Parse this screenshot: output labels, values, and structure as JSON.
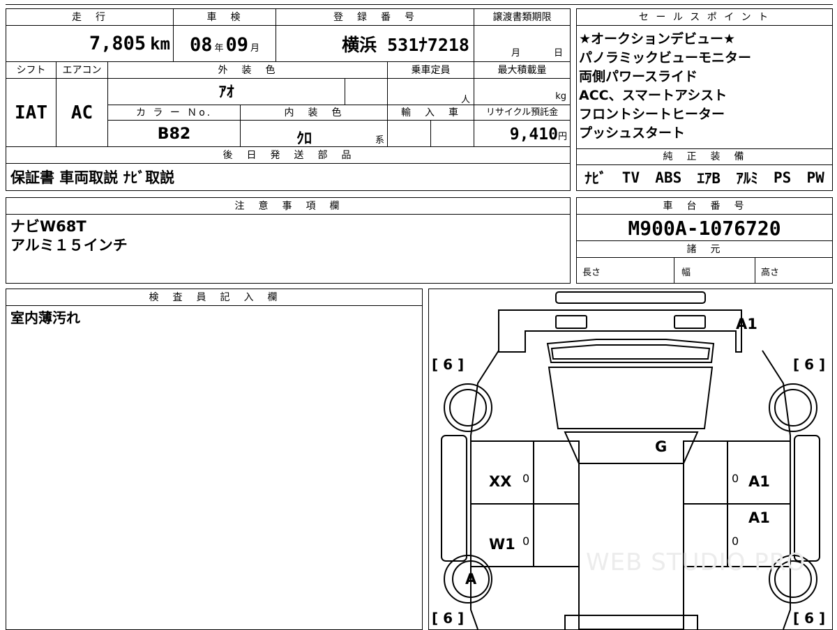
{
  "top": {
    "mileage_label": "走　行",
    "mileage_value": "7,805",
    "mileage_unit": "km",
    "inspection_label": "車　検",
    "inspection_year": "08",
    "inspection_year_unit": "年",
    "inspection_month": "09",
    "inspection_month_unit": "月",
    "registration_label": "登　録　番　号",
    "registration_value": "横浜 531ﾅ7218",
    "deadline_label": "譲渡書類期限",
    "deadline_month_unit": "月",
    "deadline_day_unit": "日",
    "shift_label": "シフト",
    "shift_value": "IAT",
    "ac_label": "エアコン",
    "ac_value": "AC",
    "exterior_color_label": "外　装　色",
    "exterior_color_value": "ｱｵ",
    "capacity_label": "乗車定員",
    "capacity_unit": "人",
    "max_load_label": "最大積載量",
    "max_load_unit": "kg",
    "color_no_label": "カ ラ ー Ｎo.",
    "color_no_value": "B82",
    "interior_color_label": "内　装　色",
    "interior_color_value": "ｸﾛ",
    "interior_color_suffix": "系",
    "import_label": "輸　入　車",
    "recycle_label": "リサイクル預託金",
    "recycle_value": "9,410",
    "recycle_unit": "円",
    "later_parts_label": "後　日　発　送　部　品",
    "later_parts_value": "保証書 車両取説 ﾅﾋﾞ取説"
  },
  "sales_points": {
    "label": "セ ー ル ス ポ イ ン ト",
    "items": [
      "★オークションデビュー★",
      "パノラミックビューモニター",
      "両側パワースライド",
      "ACC、スマートアシスト",
      "フロントシートヒーター",
      "プッシュスタート"
    ]
  },
  "genuine_equipment": {
    "label": "純　正　装　備",
    "items": [
      "ﾅﾋﾞ",
      "TV",
      "ABS",
      "ｴｱB",
      "ｱﾙﾐ",
      "PS",
      "PW"
    ]
  },
  "notes": {
    "label": "注　意　事　項　欄",
    "lines": [
      "ナビW68T",
      "アルミ１５インチ"
    ]
  },
  "chassis": {
    "label": "車　台　番　号",
    "value": "M900A-1076720",
    "spec_label": "諸　元",
    "length_label": "長さ",
    "width_label": "幅",
    "height_label": "高さ"
  },
  "inspector": {
    "label": "検　査　員　記　入　欄",
    "comment": "室内薄汚れ"
  },
  "diagram": {
    "marks": {
      "rear": "A1",
      "windshield": "G",
      "front_left_door": "XX",
      "rear_left_door": "W1",
      "right_front_door": "A1",
      "right_rear_door": "A1",
      "rear_left_tire_mark": "A",
      "tire_depth": "6",
      "door_zero": "0"
    },
    "watermark": "WEB STUDIO PRO"
  }
}
